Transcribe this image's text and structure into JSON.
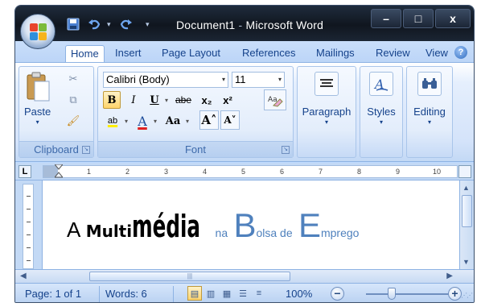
{
  "window": {
    "title_doc": "Document1",
    "title_sep": " - ",
    "title_app": "Microsoft Word",
    "minimize": "–",
    "maximize": "□",
    "close": "x"
  },
  "qat": {
    "save": "save-icon",
    "undo": "undo-icon",
    "redo": "redo-icon",
    "customize": "customize-qat-icon"
  },
  "tabs": [
    {
      "label": "Home",
      "active": true
    },
    {
      "label": "Insert"
    },
    {
      "label": "Page Layout"
    },
    {
      "label": "References"
    },
    {
      "label": "Mailings"
    },
    {
      "label": "Review"
    },
    {
      "label": "View"
    }
  ],
  "help": "?",
  "ribbon": {
    "clipboard": {
      "label": "Clipboard",
      "paste": "Paste"
    },
    "font": {
      "label": "Font",
      "font_name": "Calibri (Body)",
      "font_size": "11",
      "bold": "B",
      "italic": "I",
      "underline": "U",
      "strike": "abe",
      "subscript": "x₂",
      "superscript": "x²",
      "change_case": "Aa",
      "grow": "A˄",
      "shrink": "A˅",
      "font_color": "A",
      "highlight": "ab"
    },
    "paragraph": {
      "label": "Paragraph"
    },
    "styles": {
      "label": "Styles"
    },
    "editing": {
      "label": "Editing"
    }
  },
  "ruler": {
    "tab_selector": "L",
    "marks": [
      "1",
      "2",
      "3",
      "4",
      "5",
      "6",
      "7",
      "8",
      "9",
      "10"
    ]
  },
  "document": {
    "w1": "A",
    "w2": "Multi",
    "w3": "média",
    "w4": "na",
    "w5": "B",
    "w6": "olsa de",
    "w7": "E",
    "w8": "mprego"
  },
  "colors": {
    "accent_blue": "#4f81bd",
    "ribbon_text": "#15428b",
    "body_text": "#000000"
  },
  "status": {
    "page": "Page: 1 of 1",
    "words": "Words: 6",
    "zoom": "100%",
    "zoom_minus": "−",
    "zoom_plus": "+",
    "zoom_level": 1.0
  }
}
